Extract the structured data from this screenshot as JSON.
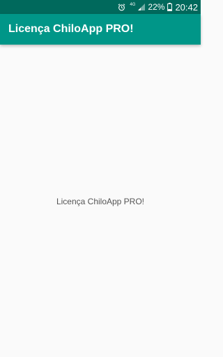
{
  "status_bar": {
    "network": "4G",
    "battery": "22%",
    "time": "20:42",
    "icons": [
      "alarm-icon",
      "signal-icon",
      "battery-icon"
    ]
  },
  "app_bar": {
    "title": "Licença ChiloApp PRO!"
  },
  "main": {
    "message": "Licença ChiloApp PRO!"
  },
  "colors": {
    "status_bar": "#00695c",
    "app_bar": "#009688",
    "background": "#fafafa",
    "text_primary": "#ffffff",
    "text_body": "#555555"
  }
}
